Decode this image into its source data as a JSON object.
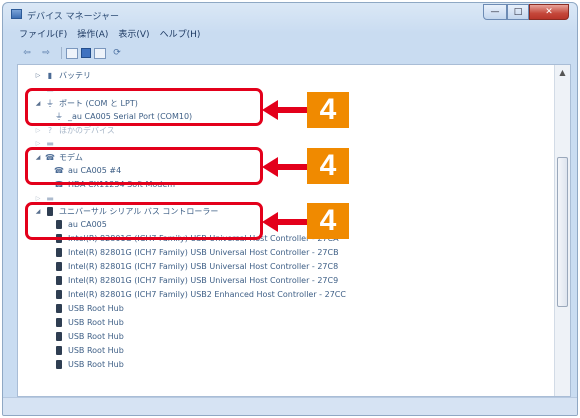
{
  "window": {
    "title": "デバイス マネージャー",
    "buttons": {
      "minimize": "—",
      "maximize": "□",
      "close": "✕"
    }
  },
  "menubar": [
    "ファイル(F)",
    "操作(A)",
    "表示(V)",
    "ヘルプ(H)"
  ],
  "toolbar": {
    "back": "⇦",
    "forward": "⇨",
    "props": "▤",
    "help": "■",
    "scan": "▦",
    "refresh": "⟳"
  },
  "tree": {
    "battery": "バッテリ",
    "ports": "ポート (COM と LPT)",
    "ports_child": "_au CA005 Serial Port (COM10)",
    "other_devices": "ほかのデバイス",
    "modem": "モデム",
    "modem_child_1": "au CA005 #4",
    "modem_child_2": "HDA CX11254 Soft Modem",
    "usb_controllers": "ユニバーサル シリアル バス コントローラー",
    "usb_children": [
      "au CA005",
      "Intel(R) 82801G (ICH7 Family) USB Universal Host Controller - 27CA",
      "Intel(R) 82801G (ICH7 Family) USB Universal Host Controller - 27CB",
      "Intel(R) 82801G (ICH7 Family) USB Universal Host Controller - 27C8",
      "Intel(R) 82801G (ICH7 Family) USB Universal Host Controller - 27C9",
      "Intel(R) 82801G (ICH7 Family) USB2 Enhanced Host Controller - 27CC",
      "USB Root Hub",
      "USB Root Hub",
      "USB Root Hub",
      "USB Root Hub",
      "USB Root Hub"
    ]
  },
  "callouts": {
    "label_1": "4",
    "label_2": "4",
    "label_3": "4"
  },
  "colors": {
    "highlight": "#e3001b",
    "badge": "#f08a00"
  }
}
